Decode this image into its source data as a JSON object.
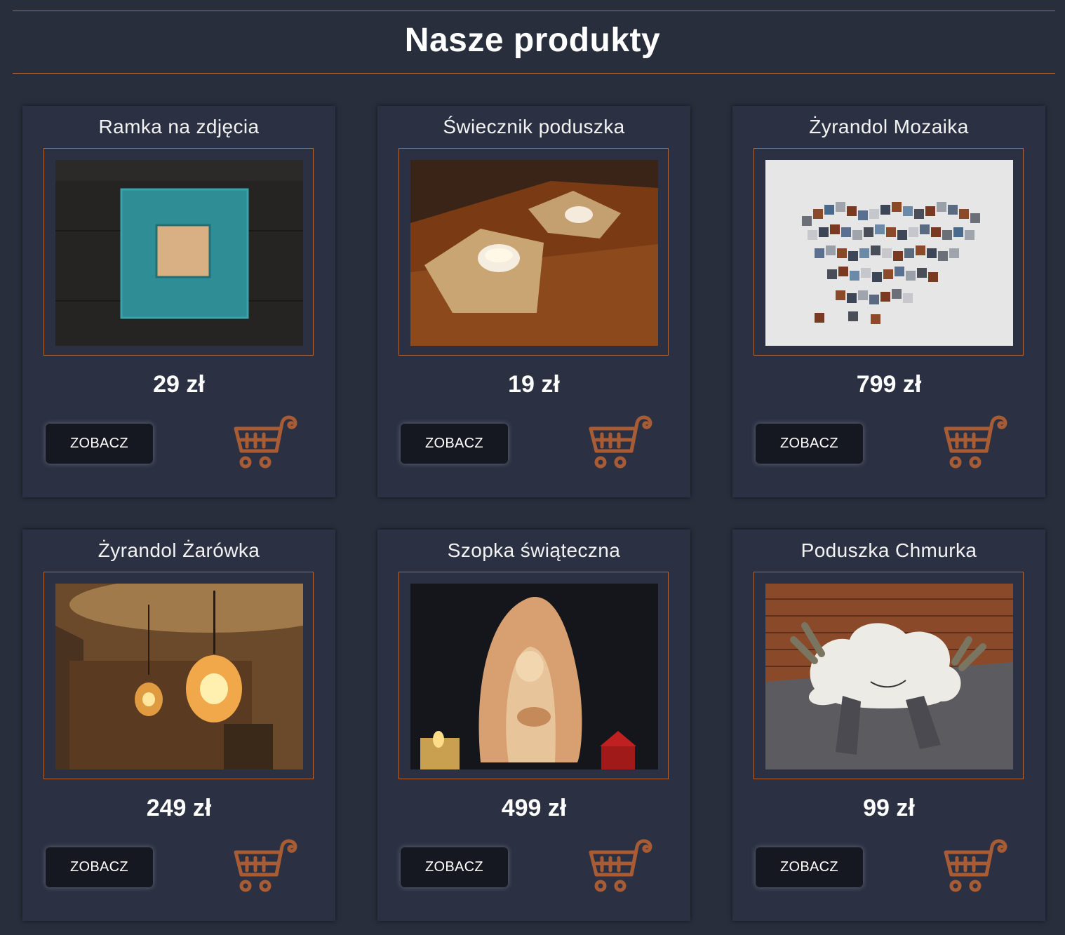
{
  "page": {
    "title": "Nasze produkty"
  },
  "colors": {
    "background": "#282e3c",
    "card": "#2b3142",
    "accent": "#b0673a",
    "button": "#151820"
  },
  "products": [
    {
      "name": "Ramka na zdjęcia",
      "price": "29 zł",
      "button_label": "ZOBACZ",
      "image": "teal-photo-frame"
    },
    {
      "name": "Świecznik poduszka",
      "price": "19 zł",
      "button_label": "ZOBACZ",
      "image": "pillow-candle-holders"
    },
    {
      "name": "Żyrandol Mozaika",
      "price": "799 zł",
      "button_label": "ZOBACZ",
      "image": "wooden-mosaic-wall-art"
    },
    {
      "name": "Żyrandol Żarówka",
      "price": "249 zł",
      "button_label": "ZOBACZ",
      "image": "bulb-shaped-pendant-lamps"
    },
    {
      "name": "Szopka świąteczna",
      "price": "499 zł",
      "button_label": "ZOBACZ",
      "image": "wooden-nativity-scene"
    },
    {
      "name": "Poduszka Chmurka",
      "price": "99 zł",
      "button_label": "ZOBACZ",
      "image": "cloud-shaped-pillow"
    }
  ],
  "icons": {
    "cart": "shopping-cart-icon"
  }
}
